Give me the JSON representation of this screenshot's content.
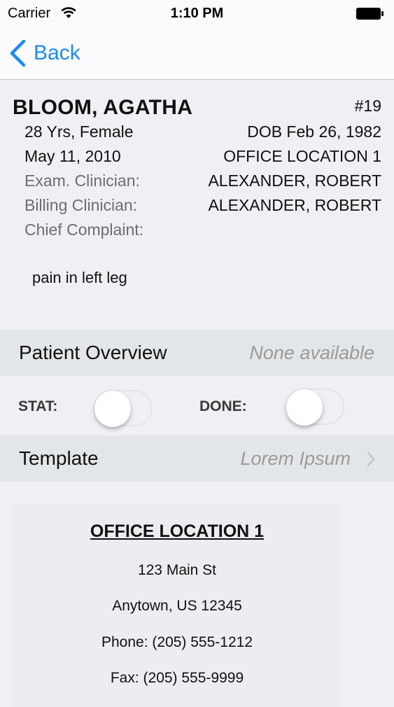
{
  "status_bar": {
    "carrier": "Carrier",
    "time": "1:10 PM",
    "wifi_icon": "wifi-icon",
    "battery_icon": "battery-icon"
  },
  "nav": {
    "back_label": "Back",
    "back_icon": "chevron-left-icon",
    "accent_color": "#1a8cf0"
  },
  "patient": {
    "name": "BLOOM, AGATHA",
    "number": "#19",
    "age_sex": "28 Yrs, Female",
    "dob": "DOB Feb 26, 1982",
    "visit_date": "May 11, 2010",
    "location": "OFFICE LOCATION 1",
    "exam_clinician_label": "Exam. Clinician:",
    "exam_clinician": "ALEXANDER, ROBERT",
    "billing_clinician_label": "Billing Clinician:",
    "billing_clinician": "ALEXANDER, ROBERT",
    "chief_complaint_label": "Chief Complaint:",
    "chief_complaint": "pain in left leg"
  },
  "overview": {
    "label": "Patient Overview",
    "value": "None available"
  },
  "toggles": {
    "stat_label": "STAT:",
    "stat_on": false,
    "done_label": "DONE:",
    "done_on": false
  },
  "template": {
    "label": "Template",
    "value": "Lorem Ipsum",
    "chevron_icon": "chevron-right-icon"
  },
  "office_card": {
    "title": "OFFICE LOCATION 1",
    "street": "123 Main St",
    "city": "Anytown, US 12345",
    "phone": "Phone: (205) 555-1212",
    "fax": "Fax: (205) 555-9999"
  }
}
